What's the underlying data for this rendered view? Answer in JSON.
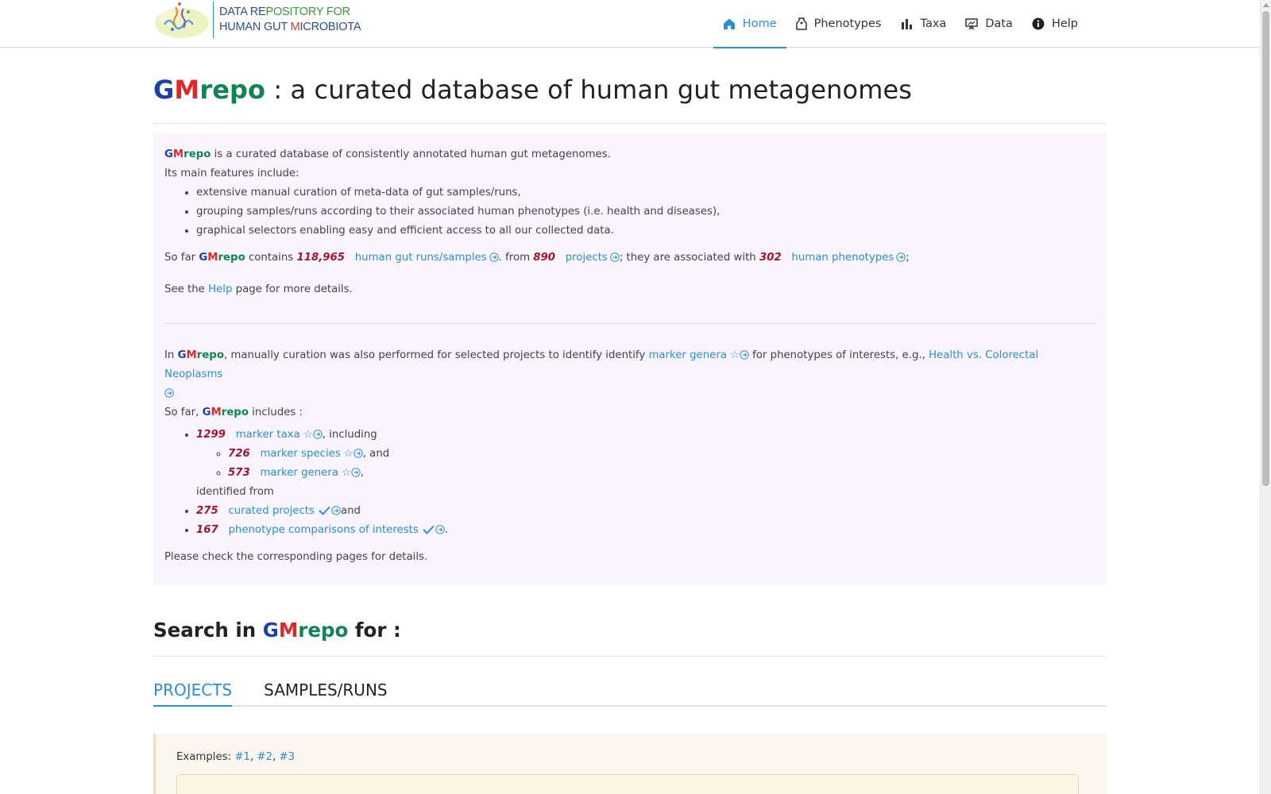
{
  "header": {
    "logo_line1_a": "DATA RE",
    "logo_line1_b": "POSITORY FOR",
    "logo_line2_a": "HUMAN GUT ",
    "logo_line2_b": "M",
    "logo_line2_c": "ICROBIOTA",
    "nav": [
      {
        "label": "Home",
        "icon": "home-icon"
      },
      {
        "label": "Phenotypes",
        "icon": "tag-icon"
      },
      {
        "label": "Taxa",
        "icon": "bar-chart-icon"
      },
      {
        "label": "Data",
        "icon": "presentation-icon"
      },
      {
        "label": "Help",
        "icon": "info-icon"
      }
    ]
  },
  "brand": {
    "g": "G",
    "m": "M",
    "repo": "repo"
  },
  "title": {
    "suffix": " : a curated database of human gut metagenomes"
  },
  "intro": {
    "line1": " is a curated database of consistently annotated human gut metagenomes.",
    "line2": "Its main features include:",
    "features": [
      "extensive manual curation of meta-data of gut samples/runs,",
      "grouping samples/runs according to their associated human phenotypes (i.e. health and diseases),",
      "graphical selectors enabling easy and efficient access to all our collected data."
    ],
    "sofar_prefix": "So far ",
    "contains": " contains ",
    "runs_count": "118,965",
    "runs_link": "human gut runs/samples",
    "from": ". from ",
    "projects_count": "890",
    "projects_link": "projects",
    "associated": "; they are associated with ",
    "phenotypes_count": "302",
    "phenotypes_link": "human phenotypes",
    "semicolon": ";",
    "see_prefix": "See the ",
    "help_link": "Help",
    "see_suffix": " page for more details."
  },
  "markers": {
    "in_prefix": "In ",
    "curation_text": ", manually curation was also performed for selected projects to identify identify ",
    "marker_genera_link": "marker genera",
    "phenotypes_text": " for phenotypes of interests, e.g., ",
    "example_link": "Health vs. Colorectal Neoplasms",
    "sofar_prefix": "So far, ",
    "includes": " includes :",
    "taxa_count": "1299",
    "taxa_link": "marker taxa",
    "including": ", including",
    "species_count": "726",
    "species_link": "marker species",
    "and1": ", and",
    "genera_count": "573",
    "genera_link": "marker genera",
    "comma": ",",
    "identified_from": "identified from",
    "curated_count": "275",
    "curated_link": "curated projects",
    "and2": "and",
    "comparisons_count": "167",
    "comparisons_link": "phenotype comparisons of interests",
    "period": ".",
    "please_check": "Please check the corresponding pages for details."
  },
  "search": {
    "title_prefix": "Search in ",
    "title_suffix": " for :",
    "tabs": [
      "PROJECTS",
      "SAMPLES/RUNS"
    ],
    "examples_label": "Examples: ",
    "examples": [
      "#1",
      "#2",
      "#3"
    ]
  },
  "colors": {
    "accent": "#2a8fd6",
    "g": "#1f3fa8",
    "m": "#e02828",
    "repo": "#118452",
    "number": "#a3152a"
  }
}
